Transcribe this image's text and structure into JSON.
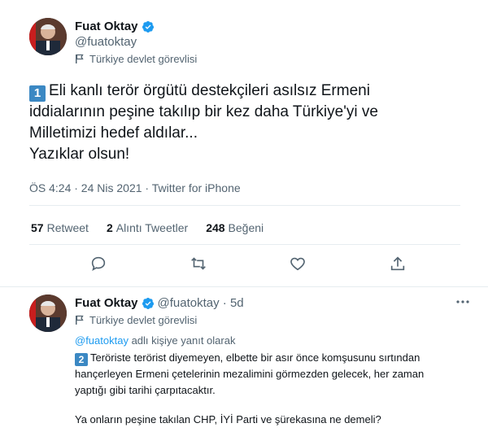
{
  "main_tweet": {
    "author_name": "Fuat Oktay",
    "author_handle": "@fuatoktay",
    "label": "Türkiye devlet görevlisi",
    "number_badge": "1",
    "line1": "Eli kanlı terör örgütü destekçileri asılsız Ermeni",
    "line2": "iddialarının peşine takılıp bir kez daha Türkiye'yi ve",
    "line3": "Milletimizi hedef aldılar...",
    "line4": "Yazıklar olsun!",
    "timestamp": "ÖS 4:24 · 24 Nis 2021 · Twitter for iPhone"
  },
  "stats": {
    "retweet_count": "57",
    "retweet_label": "Retweet",
    "quote_count": "2",
    "quote_label": "Alıntı Tweetler",
    "like_count": "248",
    "like_label": "Beğeni"
  },
  "reply_tweet": {
    "author_name": "Fuat Oktay",
    "author_handle": "@fuatoktay · 5d",
    "label": "Türkiye devlet görevlisi",
    "reply_to_handle": "@fuatoktay",
    "reply_to_text": " adlı kişiye yanıt olarak",
    "number_badge": "2",
    "line1": "Teröriste terörist diyemeyen, elbette bir asır önce komşusunu sırtından",
    "line2": "hançerleyen Ermeni çetelerinin mezalimini görmezden gelecek, her zaman",
    "line3": "yaptığı gibi tarihi çarpıtacaktır.",
    "line4": "Ya onların peşine takılan CHP, İYİ Parti ve şürekasına ne demeli?"
  },
  "icons": {
    "verified": "verified-badge-icon",
    "flag": "flag-icon",
    "reply": "reply-icon",
    "retweet": "retweet-icon",
    "like": "heart-icon",
    "share": "share-icon",
    "more": "more-icon"
  },
  "colors": {
    "verified_blue": "#1d9bf0",
    "badge_blue": "#3b88c3",
    "secondary_text": "#536471"
  }
}
